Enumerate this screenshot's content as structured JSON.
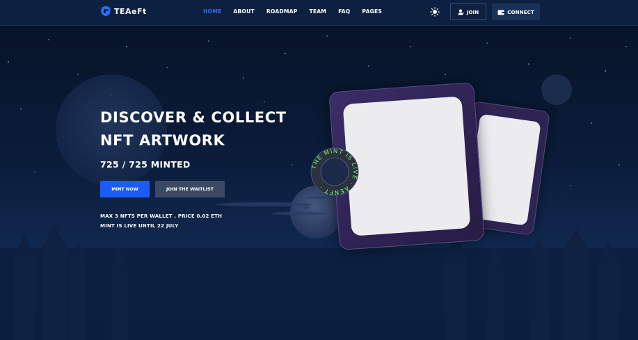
{
  "header": {
    "logo_text": "TEAeFt",
    "nav": [
      {
        "label": "HOME",
        "active": true
      },
      {
        "label": "ABOUT",
        "active": false
      },
      {
        "label": "ROADMAP",
        "active": false
      },
      {
        "label": "TEAM",
        "active": false
      },
      {
        "label": "FAQ",
        "active": false
      },
      {
        "label": "PAGES",
        "active": false
      }
    ],
    "join_label": "JOIN",
    "connect_label": "CONNECT"
  },
  "hero": {
    "title_line1": "DISCOVER & COLLECT",
    "title_line2": "NFT ARTWORK",
    "minted": "725 / 725 MINTED",
    "mint_button": "MINT NOW",
    "waitlist_button": "JOIN THE WAITLIST",
    "info_line1": "MAX 3 NFTS PER WALLET . PRICE 0.02 ETH",
    "info_line2": "MINT IS LIVE UNTIL 22 JULY",
    "badge_text": "THE MINT IS LIVE · AENFT ·"
  },
  "colors": {
    "accent": "#1a5cf5",
    "nav_active": "#2f6bff",
    "badge_text": "#7cf06a",
    "background": "#0b1a33"
  },
  "icons": {
    "logo": "shield-logo-icon",
    "theme": "sun-icon",
    "join": "user-icon",
    "connect": "wallet-icon"
  }
}
